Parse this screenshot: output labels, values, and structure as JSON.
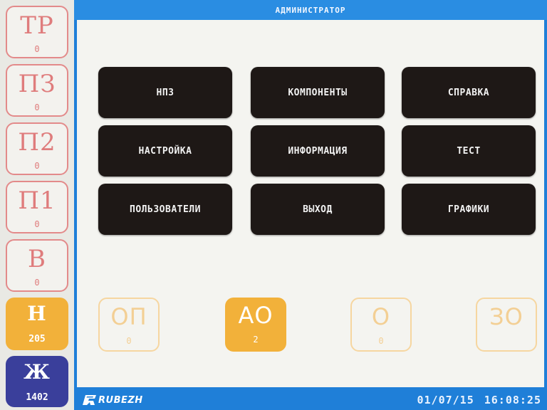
{
  "header": {
    "title": "АДМИНИСТРАТОР"
  },
  "sidebar": {
    "items": [
      {
        "label": "ТР",
        "count": "0",
        "style": "outline",
        "color": "#df7c7c"
      },
      {
        "label": "ПЗ",
        "count": "0",
        "style": "outline",
        "color": "#df7c7c"
      },
      {
        "label": "П2",
        "count": "0",
        "style": "outline",
        "color": "#df7c7c"
      },
      {
        "label": "П1",
        "count": "0",
        "style": "outline",
        "color": "#df7c7c"
      },
      {
        "label": "В",
        "count": "0",
        "style": "outline",
        "color": "#df7c7c"
      },
      {
        "label": "Н",
        "count": "205",
        "style": "filled",
        "color": "#f2b13a"
      },
      {
        "label": "Ж",
        "count": "1402",
        "style": "filled",
        "color": "#3a3f9b"
      }
    ]
  },
  "menu": {
    "buttons": [
      {
        "label": "НПЗ"
      },
      {
        "label": "КОМПОНЕНТЫ"
      },
      {
        "label": "СПРАВКА"
      },
      {
        "label": "НАСТРОЙКА"
      },
      {
        "label": "ИНФОРМАЦИЯ"
      },
      {
        "label": "ТЕСТ"
      },
      {
        "label": "ПОЛЬЗОВАТЕЛИ"
      },
      {
        "label": "ВЫХОД"
      },
      {
        "label": "ГРАФИКИ"
      }
    ]
  },
  "status": {
    "tiles": [
      {
        "label": "ОП",
        "count": "0",
        "style": "outline",
        "color": "#f3cf94"
      },
      {
        "label": "АО",
        "count": "2",
        "style": "filled",
        "color": "#f2b13a"
      },
      {
        "label": "О",
        "count": "0",
        "style": "outline",
        "color": "#f3cf94"
      },
      {
        "label": "ЗО",
        "count": "",
        "style": "outline",
        "color": "#f3cf94"
      }
    ]
  },
  "footer": {
    "logo_text": "RUBEZH",
    "logo_icon": "rubezh-logo-icon",
    "date": "01/07/15",
    "time": "16:08:25"
  },
  "colors": {
    "frame_blue": "#1f7fd8",
    "button_dark": "#1e1816",
    "alarm_red": "#df7c7c",
    "amber": "#f2b13a",
    "navy": "#3a3f9b"
  }
}
